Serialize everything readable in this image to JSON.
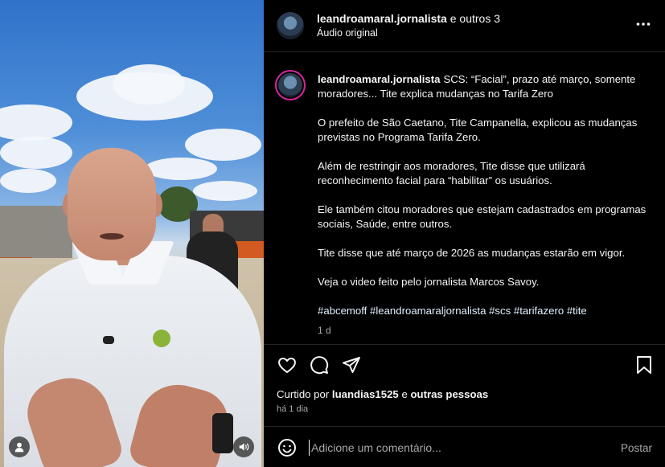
{
  "header": {
    "author": "leandroamaral.jornalista",
    "coauthors": "e outros 3",
    "audio": "Áudio original",
    "more_icon": "more-horizontal-icon"
  },
  "caption": {
    "username": "leandroamaral.jornalista",
    "paragraphs": [
      "SCS: “Facial”, prazo até março, somente moradores... Tite explica mudanças no Tarifa Zero",
      "O prefeito de São Caetano, Tite Campanella, explicou as mudanças previstas no Programa Tarifa Zero.",
      "Além de restringir aos moradores, Tite disse que utilizará reconhecimento facial para “habilitar” os usuários.",
      "Ele também citou moradores que estejam cadastrados em programas sociais, Saúde, entre outros.",
      "Tite disse que até março de 2026 as mudanças estarão em vigor.",
      "Veja o video feito pelo jornalista Marcos Savoy."
    ],
    "hashtags": "#abcemoff #leandroamaraljornalista #scs #tarifazero #tite",
    "ago": "1 d"
  },
  "actions": {
    "like_icon": "heart-icon",
    "comment_icon": "comment-icon",
    "share_icon": "send-icon",
    "save_icon": "bookmark-icon"
  },
  "likes": {
    "prefix": "Curtido por",
    "user": "luandias1525",
    "connector": "e",
    "others": "outras pessoas"
  },
  "date": "há 1 dia",
  "comment": {
    "placeholder": "Adicione um comentário...",
    "post_label": "Postar",
    "emoji_icon": "emoji-icon"
  },
  "video": {
    "user_icon": "person-icon",
    "sound_icon": "speaker-icon"
  },
  "colors": {
    "background": "#000000",
    "text": "#f5f5f5",
    "muted": "#a8a8a8",
    "hashtag": "#e0f1ff",
    "divider": "#262626"
  }
}
